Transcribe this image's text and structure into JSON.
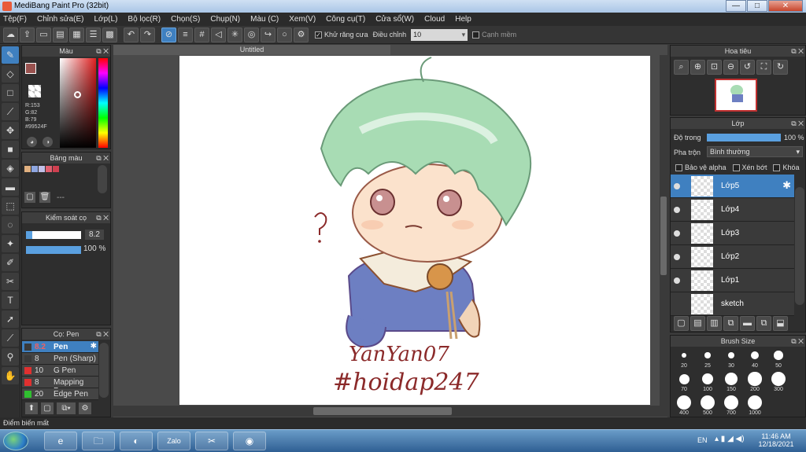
{
  "window": {
    "title": "MediBang Paint Pro (32bit)",
    "minimize": "—",
    "maximize": "□",
    "close": "✕"
  },
  "menu": [
    "Tệp(F)",
    "Chỉnh sửa(E)",
    "Lớp(L)",
    "Bộ lọc(R)",
    "Chọn(S)",
    "Chụp(N)",
    "Màu (C)",
    "Xem(V)",
    "Công cụ(T)",
    "Cửa sổ(W)",
    "Cloud",
    "Help"
  ],
  "toolbar": {
    "antialias_label": "Khử răng cưa",
    "antialias_checked": true,
    "correction_label": "Điều chỉnh",
    "correction_value": "10",
    "edge_label": "Cạnh mềm",
    "edge_checked": false
  },
  "color_panel": {
    "title": "Màu",
    "r": "R:153",
    "g": "G:82",
    "b": "B:79",
    "hex": "#99524F",
    "primary_color": "#99524F"
  },
  "palette_panel": {
    "title": "Bảng màu",
    "add_placeholder": "---",
    "swatches": [
      "#e0b080",
      "#8ea6e0",
      "#c0c0e8",
      "#e06070",
      "#d04050"
    ]
  },
  "brush_control": {
    "title": "Kiểm soát cọ",
    "size": "8.2",
    "opacity": "100 %"
  },
  "brush_list": {
    "title": "Cọ: Pen",
    "items": [
      {
        "size": "8.2",
        "name": "Pen",
        "color": "#3a3a3a",
        "selected": true
      },
      {
        "size": "8",
        "name": "Pen (Sharp)",
        "color": "#3a3a3a",
        "selected": false
      },
      {
        "size": "10",
        "name": "G Pen",
        "color": "#e03030",
        "selected": false
      },
      {
        "size": "8",
        "name": "Mapping Pen",
        "color": "#e03030",
        "selected": false
      },
      {
        "size": "20",
        "name": "Edge Pen",
        "color": "#30c030",
        "selected": false
      }
    ]
  },
  "document": {
    "tab_title": "Untitled",
    "signature_line1": "YanYan07",
    "signature_line2": "#hoidap247"
  },
  "navigator": {
    "title": "Hoa tiêu"
  },
  "layers_panel": {
    "title": "Lớp",
    "opacity_label": "Độ trong",
    "opacity_value": "100 %",
    "blend_label": "Pha trộn",
    "blend_value": "Bình thường",
    "protect_alpha": "Bảo vệ alpha",
    "clipping": "Xén bớt",
    "lock": "Khóa",
    "layers": [
      {
        "name": "Lớp5",
        "selected": true
      },
      {
        "name": "Lớp4",
        "selected": false
      },
      {
        "name": "Lớp3",
        "selected": false
      },
      {
        "name": "Lớp2",
        "selected": false
      },
      {
        "name": "Lớp1",
        "selected": false
      },
      {
        "name": "sketch",
        "selected": false
      }
    ]
  },
  "brush_size_panel": {
    "title": "Brush Size",
    "sizes": [
      "20",
      "25",
      "30",
      "40",
      "50",
      "70",
      "100",
      "150",
      "200",
      "300",
      "400",
      "500",
      "700",
      "1000"
    ]
  },
  "status": {
    "text": "Điểm biến mất"
  },
  "taskbar": {
    "language": "EN",
    "time": "11:46 AM",
    "date": "12/18/2021",
    "apps": [
      "e",
      "🗀",
      "◐",
      "Zalo",
      "✂",
      "◉"
    ]
  }
}
